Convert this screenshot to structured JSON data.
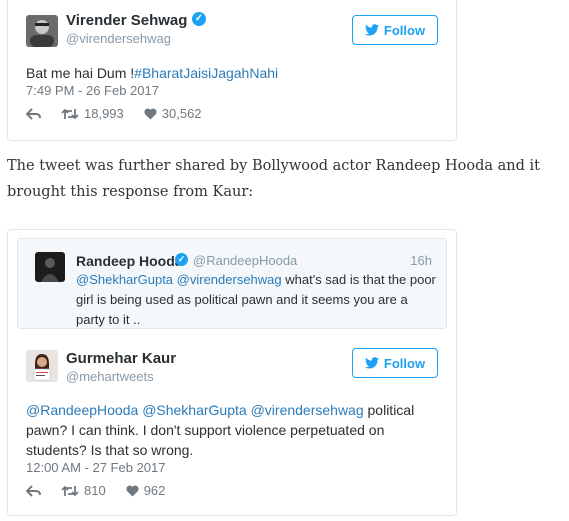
{
  "tweet1": {
    "name": "Virender Sehwag",
    "handle": "@virendersehwag",
    "follow_label": "Follow",
    "text_plain": "Bat me hai Dum !",
    "text_hashtag": "#BharatJaisiJagahNahi",
    "timestamp": "7:49 PM - 26 Feb 2017",
    "retweets": "18,993",
    "likes": "30,562",
    "verified": true
  },
  "paragraph": "The tweet was further shared by Bollywood actor Randeep Hooda and it brought this response from Kaur:",
  "tweet2": {
    "quoted": {
      "name": "Randeep Hooda",
      "handle": "@RandeepHooda",
      "time": "16h",
      "mention1": "@ShekharGupta",
      "mention2": "@virendersehwag",
      "text": " what's sad is that the poor girl is being used as political pawn and it seems you are a party to it ..",
      "verified": true
    },
    "name": "Gurmehar Kaur",
    "handle": "@mehartweets",
    "follow_label": "Follow",
    "mention1": "@RandeepHooda",
    "mention2": "@ShekharGupta",
    "mention3": "@virendersehwag",
    "text": " political pawn? I can think. I don't support violence perpetuated on students? Is that so wrong.",
    "timestamp": "12:00 AM - 27 Feb 2017",
    "retweets": "810",
    "likes": "962"
  },
  "colors": {
    "link": "#2b7bb9",
    "twitter_blue": "#1da1f2",
    "muted": "#707980"
  },
  "icons": [
    "reply-icon",
    "retweet-icon",
    "heart-icon",
    "twitter-bird-icon",
    "verified-badge-icon"
  ]
}
